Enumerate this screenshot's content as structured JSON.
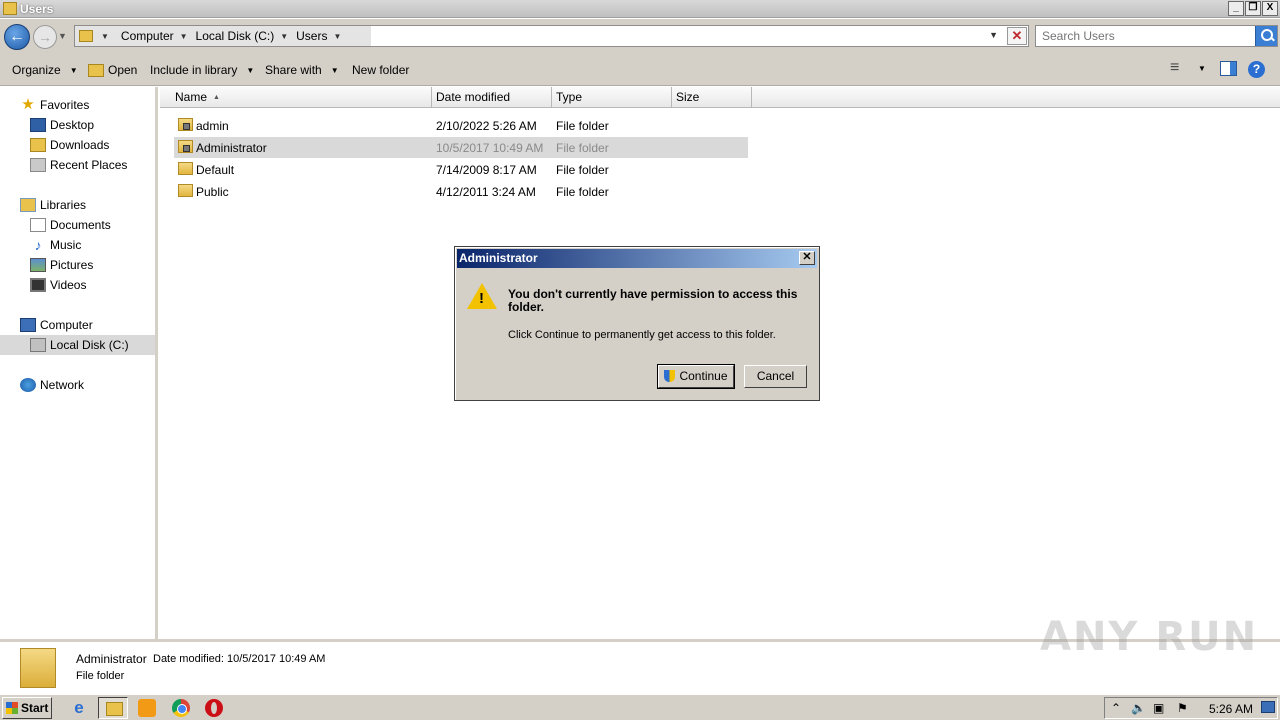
{
  "window": {
    "title": "Users",
    "min_label": "_",
    "max_label": "❐",
    "close_label": "X"
  },
  "address": {
    "crumbs": [
      "Computer",
      "Local Disk (C:)",
      "Users"
    ],
    "refresh_glyph": "✕",
    "search_placeholder": "Search Users"
  },
  "toolbar": {
    "organize": "Organize",
    "open": "Open",
    "include_in_library": "Include in library",
    "share_with": "Share with",
    "new_folder": "New folder"
  },
  "nav": {
    "favorites": "Favorites",
    "desktop": "Desktop",
    "downloads": "Downloads",
    "recent_places": "Recent Places",
    "libraries": "Libraries",
    "documents": "Documents",
    "music": "Music",
    "pictures": "Pictures",
    "videos": "Videos",
    "computer": "Computer",
    "local_disk": "Local Disk (C:)",
    "network": "Network"
  },
  "columns": {
    "name": "Name",
    "date_modified": "Date modified",
    "type": "Type",
    "size": "Size"
  },
  "files": [
    {
      "name": "admin",
      "date": "2/10/2022 5:26 AM",
      "type": "File folder"
    },
    {
      "name": "Administrator",
      "date": "10/5/2017 10:49 AM",
      "type": "File folder"
    },
    {
      "name": "Default",
      "date": "7/14/2009 8:17 AM",
      "type": "File folder"
    },
    {
      "name": "Public",
      "date": "4/12/2011 3:24 AM",
      "type": "File folder"
    }
  ],
  "details": {
    "name": "Administrator",
    "date_label": "Date modified:",
    "date": "10/5/2017 10:49 AM",
    "type": "File folder"
  },
  "dialog": {
    "title": "Administrator",
    "close": "✕",
    "message": "You don't currently have permission to access this folder.",
    "sub": "Click Continue to permanently get access to this folder.",
    "continue": "Continue",
    "cancel": "Cancel"
  },
  "taskbar": {
    "start": "Start",
    "clock": "5:26 AM"
  },
  "watermark": "ANY RUN",
  "colors": {
    "chrome_bg": "#d4d0c8",
    "dialog_title_start": "#0a246a",
    "dialog_title_end": "#a6caf0",
    "selection": "#d9d9d9",
    "folder": "#e8c24a"
  },
  "icons": {
    "back": "back-arrow-icon",
    "forward": "forward-arrow-icon",
    "search": "search-icon",
    "warning": "warning-icon",
    "help": "help-icon"
  }
}
